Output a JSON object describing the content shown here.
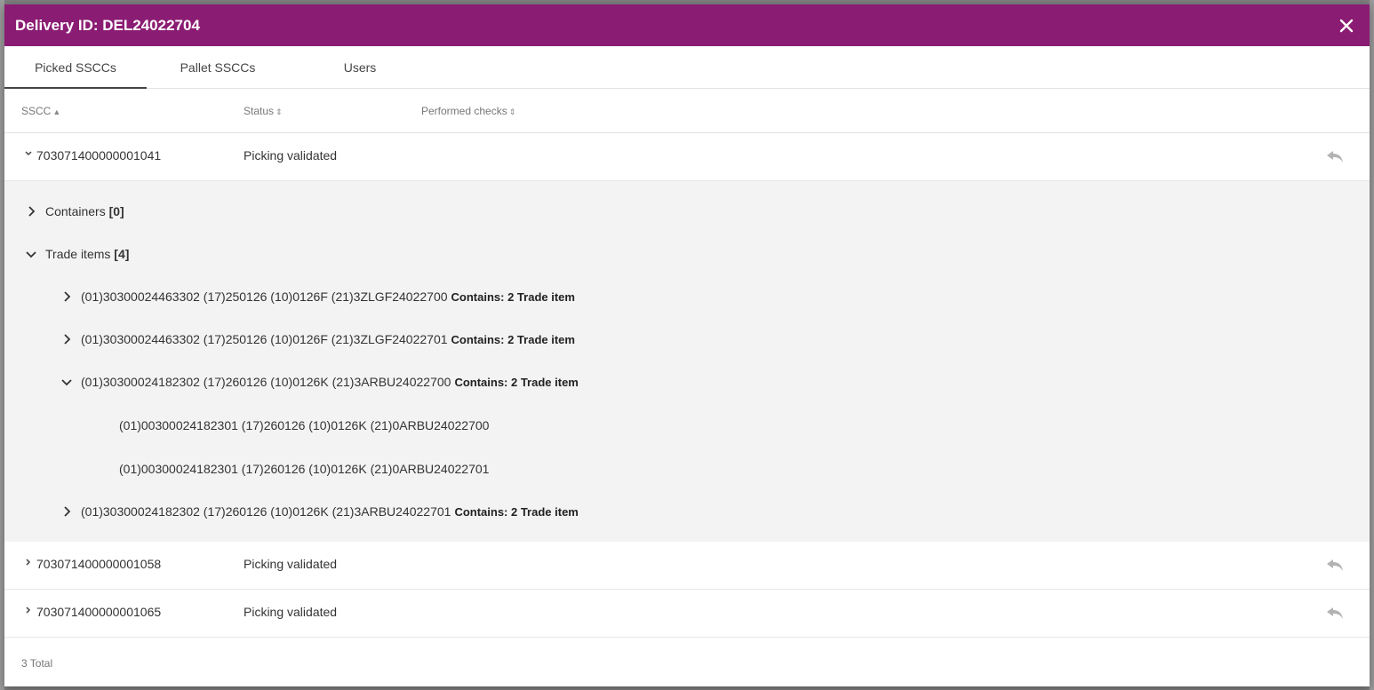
{
  "modal": {
    "title": "Delivery ID: DEL24022704"
  },
  "tabs": [
    {
      "label": "Picked SSCCs",
      "active": true
    },
    {
      "label": "Pallet SSCCs",
      "active": false
    },
    {
      "label": "Users",
      "active": false
    }
  ],
  "columns": {
    "sscc": "SSCC",
    "status": "Status",
    "checks": "Performed checks"
  },
  "rows": [
    {
      "sscc": "703071400000001041",
      "status": "Picking validated",
      "expanded": true
    },
    {
      "sscc": "703071400000001058",
      "status": "Picking validated",
      "expanded": false
    },
    {
      "sscc": "703071400000001065",
      "status": "Picking validated",
      "expanded": false
    }
  ],
  "detail": {
    "containers_label": "Containers",
    "containers_count": "[0]",
    "trade_items_label": "Trade items",
    "trade_items_count": "[4]",
    "items": [
      {
        "code": "(01)30300024463302 (17)250126 (10)0126F (21)3ZLGF24022700",
        "contains": "Contains: 2 Trade item"
      },
      {
        "code": "(01)30300024463302 (17)250126 (10)0126F (21)3ZLGF24022701",
        "contains": "Contains: 2 Trade item"
      },
      {
        "code": "(01)30300024182302 (17)260126 (10)0126K (21)3ARBU24022700",
        "contains": "Contains: 2 Trade item"
      },
      {
        "code": "(01)30300024182302 (17)260126 (10)0126K (21)3ARBU24022701",
        "contains": "Contains: 2 Trade item"
      }
    ],
    "sub_items": [
      "(01)00300024182301 (17)260126 (10)0126K (21)0ARBU24022700",
      "(01)00300024182301 (17)260126 (10)0126K (21)0ARBU24022701"
    ]
  },
  "footer": {
    "total": "3 Total"
  },
  "colors": {
    "header": "#8b1c73",
    "detail_bg": "#f3f3f3"
  }
}
